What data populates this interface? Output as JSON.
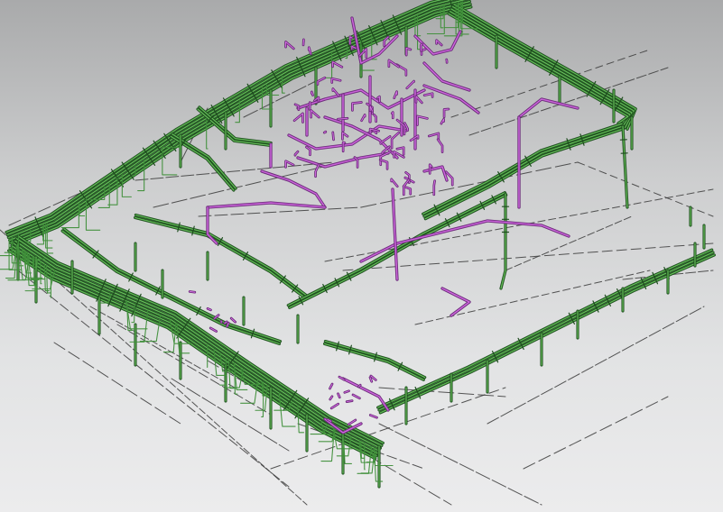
{
  "view": {
    "type": "isometric-3d-model",
    "background_top": "#a9aaab",
    "background_bottom": "#ececed"
  },
  "systems": [
    {
      "id": "main",
      "color": "#3f8f3a",
      "highlight": "#7fd16f",
      "dark": "#1e4d1e"
    },
    {
      "id": "secondary",
      "color": "#b04fc0",
      "highlight": "#e27ff0",
      "dark": "#6a2a78"
    },
    {
      "id": "reference",
      "color": "#3a3a3a"
    }
  ]
}
